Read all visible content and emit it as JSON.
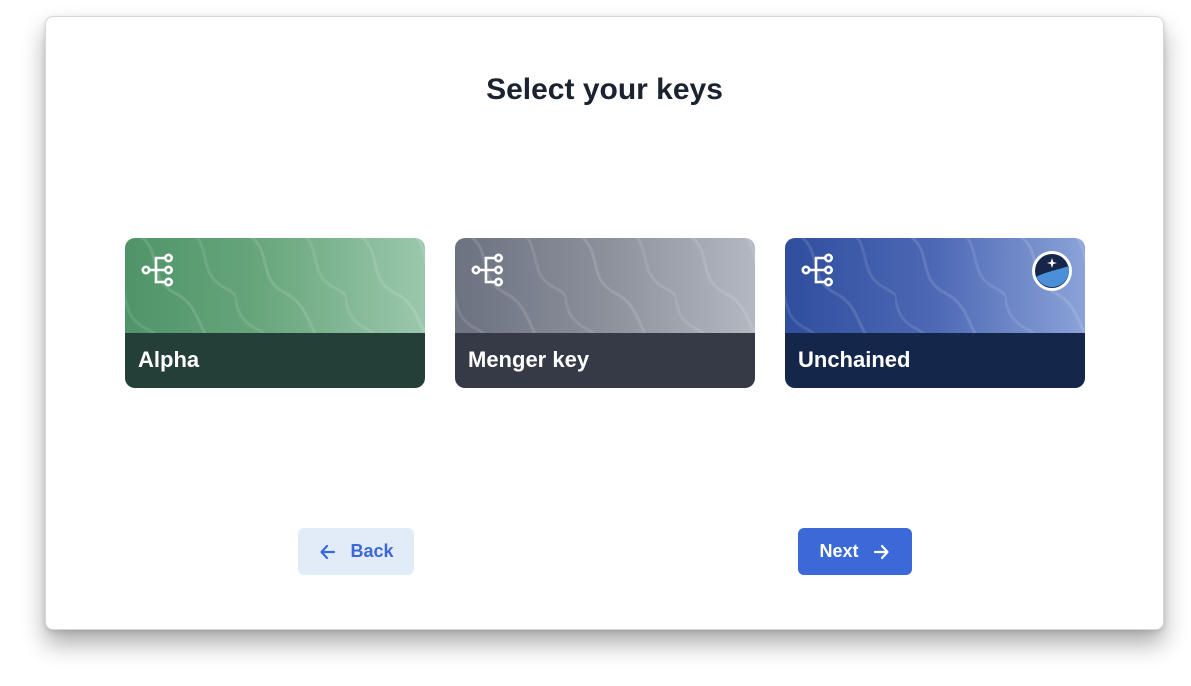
{
  "page": {
    "title": "Select your keys"
  },
  "cards": [
    {
      "label": "Alpha",
      "color": "#4f9468",
      "footer_color": "#243f37",
      "icon": "key-tree-icon"
    },
    {
      "label": "Menger key",
      "color": "#6b7280",
      "footer_color": "#363a46",
      "icon": "key-tree-icon"
    },
    {
      "label": "Unchained",
      "color": "#2f4e9e",
      "footer_color": "#14264a",
      "icon": "key-tree-icon",
      "badge": "unchained-logo-icon"
    }
  ],
  "buttons": {
    "back_label": "Back",
    "next_label": "Next",
    "accent_color": "#3b69d8"
  }
}
